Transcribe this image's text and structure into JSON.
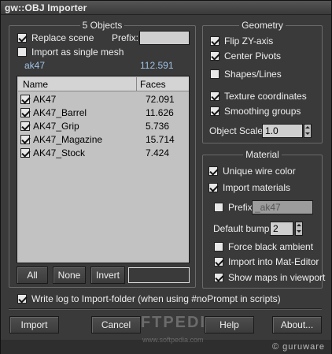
{
  "window": {
    "title": "gw::OBJ Importer"
  },
  "objects_group": {
    "title": "5 Objects",
    "replace_scene": {
      "label": "Replace scene",
      "checked": true
    },
    "prefix": {
      "label": "Prefix:",
      "value": ""
    },
    "import_single_mesh": {
      "label": "Import as single mesh",
      "checked": false
    },
    "summary": {
      "name": "ak47",
      "faces": "112.591"
    },
    "list": {
      "headers": {
        "name": "Name",
        "faces": "Faces"
      },
      "rows": [
        {
          "name": "AK47",
          "faces": "72.091",
          "checked": true
        },
        {
          "name": "AK47_Barrel",
          "faces": "11.626",
          "checked": true
        },
        {
          "name": "AK47_Grip",
          "faces": "5.736",
          "checked": true
        },
        {
          "name": "AK47_Magazine",
          "faces": "15.714",
          "checked": true
        },
        {
          "name": "AK47_Stock",
          "faces": "7.424",
          "checked": true
        }
      ]
    },
    "buttons": {
      "all": "All",
      "none": "None",
      "invert": "Invert"
    },
    "filter_value": ""
  },
  "geometry_group": {
    "title": "Geometry",
    "flip_zy": {
      "label": "Flip ZY-axis",
      "checked": true
    },
    "center_pivots": {
      "label": "Center Pivots",
      "checked": true
    },
    "shapes_lines": {
      "label": "Shapes/Lines",
      "checked": false
    },
    "texture_coords": {
      "label": "Texture coordinates",
      "checked": true
    },
    "smoothing_groups": {
      "label": "Smoothing groups",
      "checked": true
    },
    "object_scale": {
      "label": "Object Scale:",
      "value": "1.0"
    }
  },
  "material_group": {
    "title": "Material",
    "unique_wire": {
      "label": "Unique wire color",
      "checked": true
    },
    "import_materials": {
      "label": "Import materials",
      "checked": true
    },
    "prefix": {
      "label": "Prefix:",
      "value": "_ak47",
      "checked": false
    },
    "default_bump": {
      "label": "Default bump:",
      "value": "2"
    },
    "force_black_ambient": {
      "label": "Force black ambient",
      "checked": false
    },
    "import_mat_editor": {
      "label": "Import into Mat-Editor",
      "checked": true
    },
    "show_maps": {
      "label": "Show maps in viewport",
      "checked": true
    }
  },
  "write_log": {
    "label": "Write log to Import-folder (when using #noPrompt in scripts)",
    "checked": true
  },
  "bottom_buttons": {
    "import": "Import",
    "cancel": "Cancel",
    "help": "Help",
    "about": "About..."
  },
  "watermark": {
    "text": "SOFTPEDIA",
    "url": "www.softpedia.com"
  },
  "brand": "© guruware"
}
